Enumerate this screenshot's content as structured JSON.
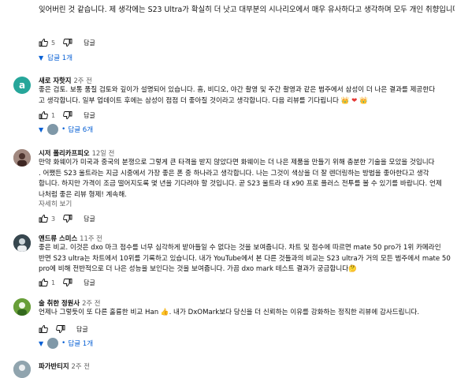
{
  "top_comment": {
    "text": "잊어버린 것 같습니다. 제 생각에는 S23 Ultra가 확실히 더 낫고 대부분의 시나리오에서 매우 유사하다고 생각하며 모두 개인 취향입니다!",
    "likes": "5",
    "reply_label": "답글",
    "replies_label": "답글 1개"
  },
  "comments": [
    {
      "author": "새로 자핫지",
      "time": "2주 전",
      "avatar_letter": "a",
      "avatar_color": "#26a69a",
      "lines": [
        "좋은 검토. 보통 품질 검토와 깊이가 설명되어 있습니다. 흠, 비디오, 야간 촬영 및 주간 촬영과 같은 범주에서 삼성이 더 나은 결과를 제공한다",
        "고 생각합니다. 일부 업데이트 후에는 삼성이 점점 더 좋아질 것이라고 생각합니다. 다음 리뷰를 기다립니다"
      ],
      "emoji_tail": "👑 ❤ 👑",
      "likes": "1",
      "reply_label": "답글",
      "replies_label": "답글 6개"
    },
    {
      "author": "시저 폴리카프피오",
      "time": "12일 전",
      "lines": [
        "만약 화웨이가 미국과 중국의 분쟁으로 그렇게 큰 타격을 받지 않았다면 화웨이는 더 나은 제품을 만들기 위해 충분한 기술을 모았을 것입니다",
        ". 어쨌든 S23 울트라는 지금 시중에서 가장 좋은 폰 중 하나라고 생각합니다. 나는 그것이 색상을 더 잘 렌더링하는 방법을 좋아한다고 생각",
        "합니다. 하지만 가격이 조금 떨어지도록 몇 년을 기다려야 할 것입니다. 곧 S23 울트라 대 x90 프로 플러스 전투를 볼 수 있기를 바랍니다. 언제",
        "나처럼 좋은 리뷰 형제! 계속해."
      ],
      "more_label": "자세히 보기",
      "likes": "3",
      "reply_label": "답글"
    },
    {
      "author": "앤드류 스미스",
      "time": "11주 전",
      "lines": [
        "좋은 비교. 이것은 dxo 마크 점수를 너무 심각하게 받아들일 수 없다는 것을 보여줍니다. 차트 및 점수에 따르면 mate 50 pro가 1위 카메라인",
        "반면 S23 ultra는 차트에서 10위를 기록하고 있습니다. 내가 YouTube에서 본 다른 것들과의 비교는 S23 ultra가 거의 모든 범주에서 mate 50",
        "pro에 비해 전반적으로 더 나은 성능을 보인다는 것을 보여줍니다. 가끔 dxo mark 테스트 결과가 궁금합니다"
      ],
      "emoji_tail": "🤔",
      "likes": "1",
      "reply_label": "답글"
    },
    {
      "author": "술 취한 정원사",
      "time": "2주 전",
      "lines": [
        "언제나 그렇듯이 또 다른 훌륭한 비교 Han 👍.   내가 DxOMark보다 당신을 더 신뢰하는 이유를 강화하는 정직한 리뷰에 감사드립니다."
      ],
      "reply_label": "답글",
      "replies_label": "답글 1개"
    },
    {
      "author": "파가반티지",
      "time": "2주 전"
    }
  ],
  "colors": {
    "link": "#065fd4",
    "meta": "#606060",
    "text": "#0f0f0f"
  }
}
